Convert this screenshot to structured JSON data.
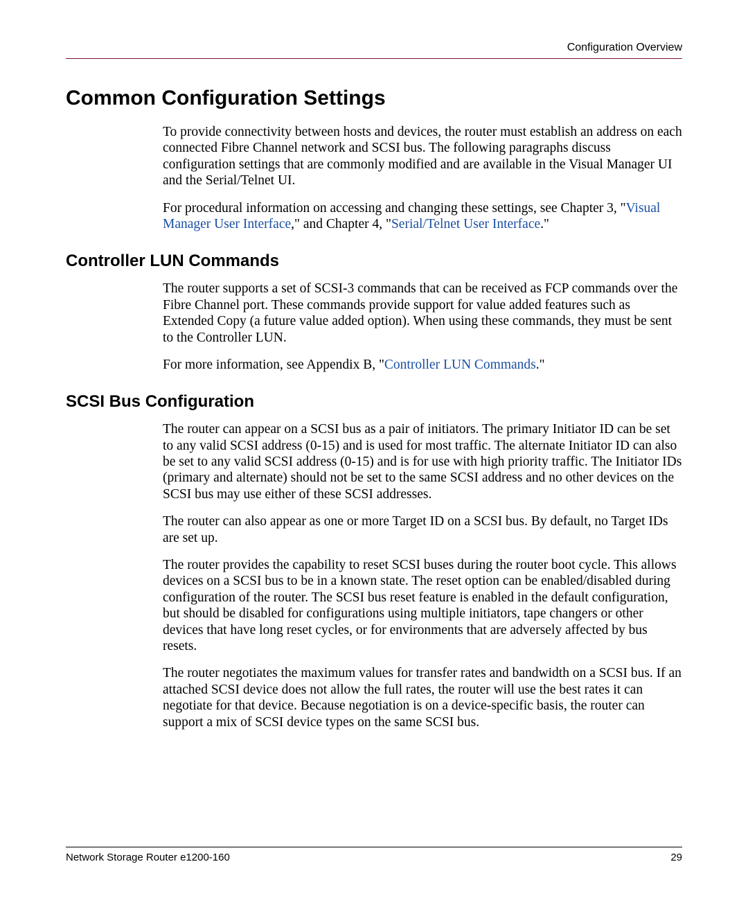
{
  "header": {
    "running_title": "Configuration Overview"
  },
  "h1": "Common Configuration Settings",
  "intro": {
    "p1": "To provide connectivity between hosts and devices, the router must establish an address on each connected Fibre Channel network and SCSI bus. The following paragraphs discuss configuration settings that are commonly modified and are available in the Visual Manager UI and the Serial/Telnet UI.",
    "p2_pre": "For procedural information on accessing and changing these settings, see Chapter 3, \"",
    "p2_link1": "Visual Manager User Interface",
    "p2_mid": ",\" and Chapter 4, \"",
    "p2_link2": "Serial/Telnet User Interface",
    "p2_post": ".\""
  },
  "section1": {
    "title": "Controller LUN Commands",
    "p1": "The router supports a set of SCSI-3 commands that can be received as FCP commands over the Fibre Channel port. These commands provide support for value added features such as Extended Copy (a future value added option). When using these commands, they must be sent to the Controller LUN.",
    "p2_pre": "For more information, see Appendix B, \"",
    "p2_link": "Controller LUN Commands",
    "p2_post": ".\""
  },
  "section2": {
    "title": "SCSI Bus Configuration",
    "p1": "The router can appear on a SCSI bus as a pair of initiators. The primary Initiator ID can be set to any valid SCSI address (0-15) and is used for most traffic. The alternate Initiator ID can also be set to any valid SCSI address (0-15) and is for use with high priority traffic. The Initiator IDs (primary and alternate) should not be set to the same SCSI address and no other devices on the SCSI bus may use either of these SCSI addresses.",
    "p2": "The router can also appear as one or more Target ID on a SCSI bus. By default, no Target IDs are set up.",
    "p3": "The router provides the capability to reset SCSI buses during the router boot cycle. This allows devices on a SCSI bus to be in a known state. The reset option can be enabled/disabled during configuration of the router. The SCSI bus reset feature is enabled in the default configuration, but should be disabled for configurations using multiple initiators, tape changers or other devices that have long reset cycles, or for environments that are adversely affected by bus resets.",
    "p4": "The router negotiates the maximum values for transfer rates and bandwidth on a SCSI bus. If an attached SCSI device does not allow the full rates, the router will use the best rates it can negotiate for that device. Because negotiation is on a device-specific basis, the router can support a mix of SCSI device types on the same SCSI bus."
  },
  "footer": {
    "left": "Network Storage Router e1200-160",
    "right": "29"
  }
}
